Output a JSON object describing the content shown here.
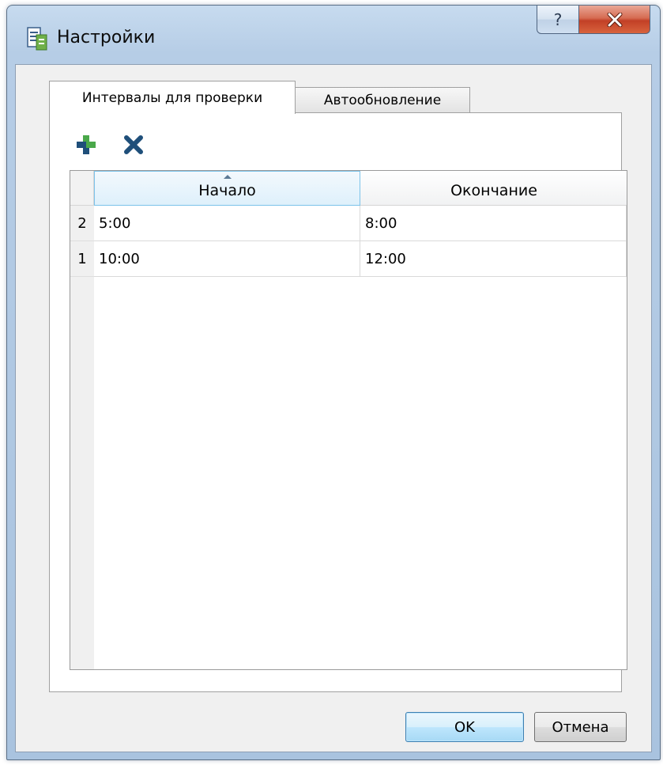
{
  "window": {
    "title": "Настройки",
    "help_label": "?"
  },
  "tabs": [
    {
      "label": "Интервалы для проверки",
      "active": true
    },
    {
      "label": "Автообновление",
      "active": false
    }
  ],
  "toolbar": {
    "add_icon": "add-icon",
    "delete_icon": "delete-icon"
  },
  "table": {
    "columns": [
      "Начало",
      "Окончание"
    ],
    "sorted_column": "Начало",
    "rows": [
      {
        "num": "2",
        "start": "5:00",
        "end": "8:00"
      },
      {
        "num": "1",
        "start": "10:00",
        "end": "12:00"
      }
    ]
  },
  "buttons": {
    "ok_label": "OK",
    "cancel_label": "Отмена"
  },
  "colors": {
    "accent": "#3c7fb1",
    "close_red": "#c24026",
    "add_green": "#4aa84a",
    "icon_blue": "#1f4f7a"
  }
}
